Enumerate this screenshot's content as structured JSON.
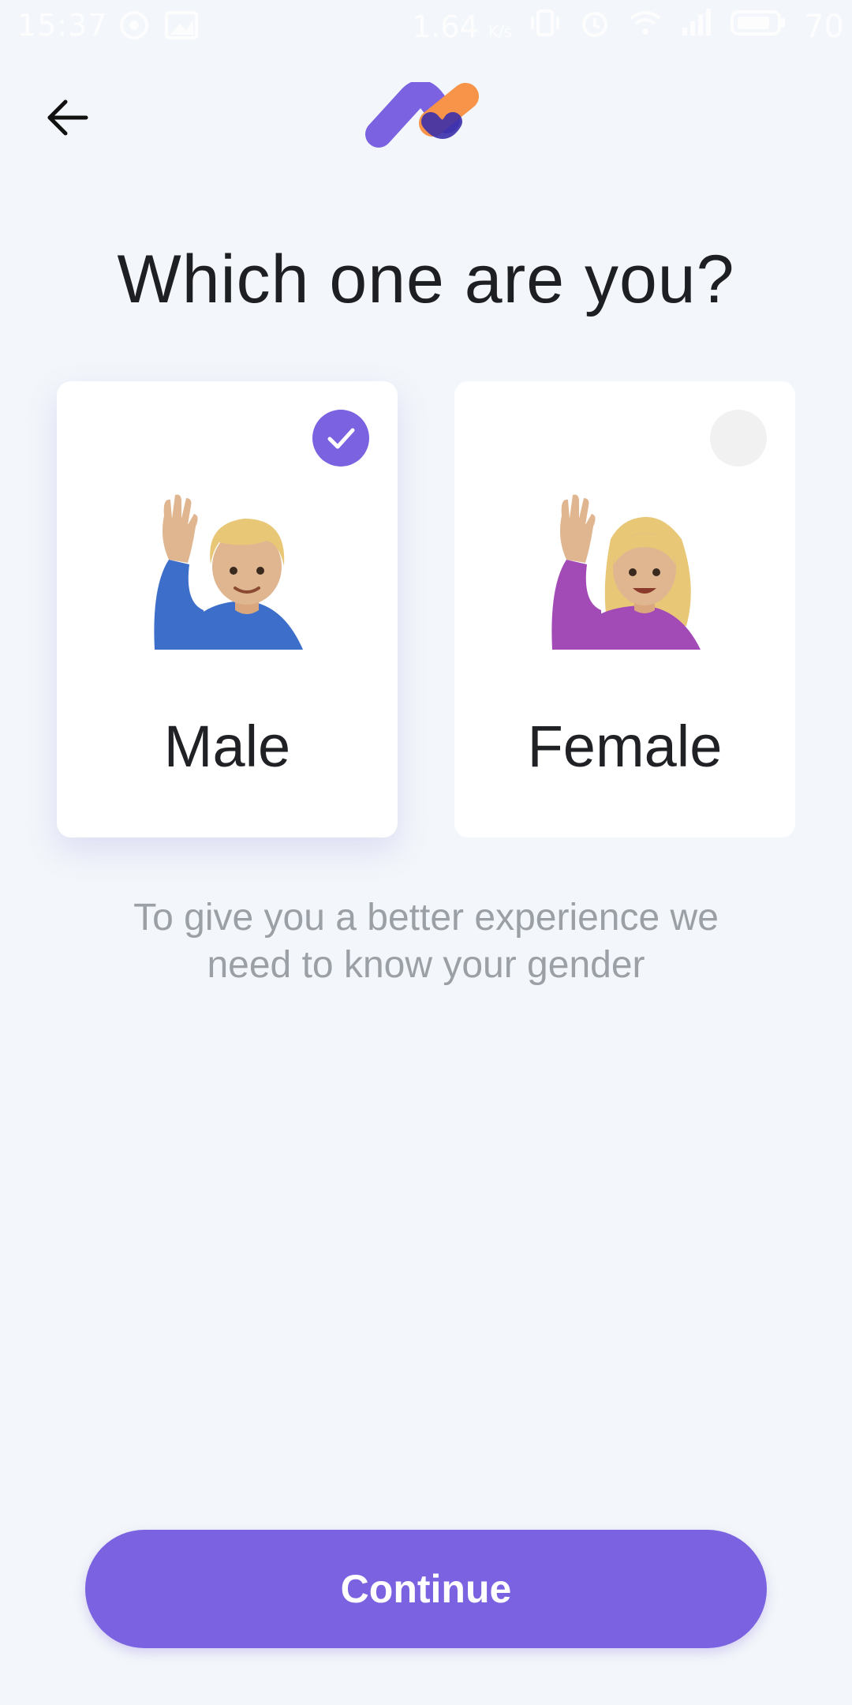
{
  "status_bar": {
    "time": "15:37",
    "network_speed": "1.64",
    "network_unit": "K/s",
    "battery": "70"
  },
  "header": {
    "back_icon": "arrow-left-icon",
    "logo": "app-logo"
  },
  "title": "Which one are you?",
  "options": [
    {
      "label": "Male",
      "selected": true,
      "icon": "man-raising-hand-icon"
    },
    {
      "label": "Female",
      "selected": false,
      "icon": "woman-raising-hand-icon"
    }
  ],
  "subtitle": "To give you a better experience we need to know your gender",
  "continue_label": "Continue",
  "colors": {
    "accent": "#7a62e0",
    "logo_orange": "#f7944a",
    "background": "#f3f6fa"
  }
}
